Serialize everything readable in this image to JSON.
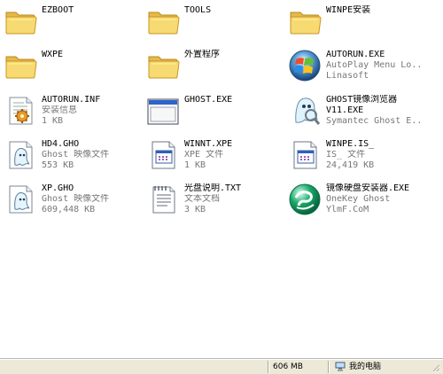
{
  "window": {
    "background": "#ffffff"
  },
  "files": [
    {
      "name": "EZBOOT",
      "icon": "folder-icon",
      "lines": []
    },
    {
      "name": "TOOLS",
      "icon": "folder-icon",
      "lines": []
    },
    {
      "name": "WINPE安装",
      "icon": "folder-icon",
      "lines": []
    },
    {
      "name": "WXPE",
      "icon": "folder-icon",
      "lines": []
    },
    {
      "name": "外置程序",
      "icon": "folder-icon",
      "lines": []
    },
    {
      "name": "AUTORUN.EXE",
      "icon": "windows-logo-icon",
      "lines": [
        "AutoPlay Menu Lo...",
        "Linasoft"
      ]
    },
    {
      "name": "AUTORUN.INF",
      "icon": "setup-info-icon",
      "lines": [
        "安装信息",
        "1 KB"
      ]
    },
    {
      "name": "GHOST.EXE",
      "icon": "application-window-icon",
      "lines": []
    },
    {
      "name": "GHOST镜像浏览器",
      "icon": "ghost-explorer-icon",
      "lines": [
        "V11.EXE",
        "Symantec Ghost E..."
      ]
    },
    {
      "name": "HD4.GHO",
      "icon": "ghost-image-icon",
      "lines": [
        "Ghost 映像文件",
        "553 KB"
      ]
    },
    {
      "name": "WINNT.XPE",
      "icon": "document-window-icon",
      "lines": [
        "XPE 文件",
        "1 KB"
      ]
    },
    {
      "name": "WINPE.IS_",
      "icon": "document-window-icon",
      "lines": [
        "IS_ 文件",
        "24,419 KB"
      ]
    },
    {
      "name": "XP.GHO",
      "icon": "ghost-image-icon",
      "lines": [
        "Ghost 映像文件",
        "609,448 KB"
      ]
    },
    {
      "name": "光盘说明.TXT",
      "icon": "text-document-icon",
      "lines": [
        "文本文档",
        "3 KB"
      ]
    },
    {
      "name": "镜像硬盘安装器.EXE",
      "icon": "onekey-ghost-icon",
      "lines": [
        "OneKey Ghost",
        "YlmF.CoM"
      ]
    }
  ],
  "status": {
    "size": "606 MB",
    "location": "我的电脑"
  },
  "colors": {
    "folder": "#f6d66b",
    "folder_dark": "#c99722",
    "status_bg": "#ece9d8",
    "ghost_blue": "#2875c7",
    "onekey_green": "#19a86a"
  }
}
